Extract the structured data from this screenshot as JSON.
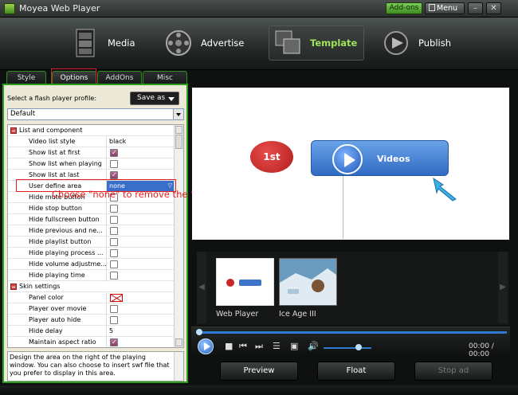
{
  "window": {
    "title": "Moyea Web Player",
    "addons": "Add-ons",
    "menu": "Menu",
    "minimize": "–",
    "close": "✕"
  },
  "toolbar": [
    {
      "label": "Media",
      "icon": "film-icon"
    },
    {
      "label": "Advertise",
      "icon": "reel-icon"
    },
    {
      "label": "Template",
      "icon": "template-icon",
      "active": true
    },
    {
      "label": "Publish",
      "icon": "publish-icon"
    }
  ],
  "tabs": [
    "Style",
    "Options",
    "AddOns",
    "Misc"
  ],
  "profile": {
    "label": "Select a flash player profile:",
    "save_as": "Save as",
    "selected": "Default"
  },
  "grid": {
    "rows": [
      {
        "type": "section",
        "name": "List and component"
      },
      {
        "name": "Video list style",
        "value": "black"
      },
      {
        "name": "Show list at first",
        "check": true
      },
      {
        "name": "Show list when playing",
        "check": false
      },
      {
        "name": "Show list at last",
        "check": true
      },
      {
        "name": "User define area",
        "value": "none",
        "selected": true
      },
      {
        "name": "Hide mute button",
        "check": false
      },
      {
        "name": "Hide stop button",
        "check": false
      },
      {
        "name": "Hide fullscreen button",
        "check": false
      },
      {
        "name": "Hide previous and ne...",
        "check": false
      },
      {
        "name": "Hide playlist button",
        "check": false
      },
      {
        "name": "Hide playing process ...",
        "check": false
      },
      {
        "name": "Hide volume adjustme...",
        "check": false
      },
      {
        "name": "Hide playing time",
        "check": false
      },
      {
        "type": "section",
        "name": "Skin settings"
      },
      {
        "name": "Panel color",
        "swatch": true
      },
      {
        "name": "Player over movie",
        "check": false
      },
      {
        "name": "Player auto hide",
        "check": false
      },
      {
        "name": "Hide delay",
        "value": "5"
      },
      {
        "name": "Maintain aspect ratio",
        "check": true
      }
    ]
  },
  "description": "Design the area on the right of the playing window. You can also choose to insert swf file that you prefer to display in this area.",
  "annotation": "Choose \"none\" to remove the \"embed & URL area\"",
  "preview": {
    "badge": "1st",
    "videos_label": "Videos"
  },
  "thumbnails": [
    {
      "label": "Web Player"
    },
    {
      "label": "Ice Age III"
    }
  ],
  "player": {
    "time": "00:00 / 00:00",
    "progress": 0.0,
    "volume": 0.7
  },
  "actions": {
    "preview": "Preview",
    "float": "Float",
    "stop_ad": "Stop ad"
  }
}
